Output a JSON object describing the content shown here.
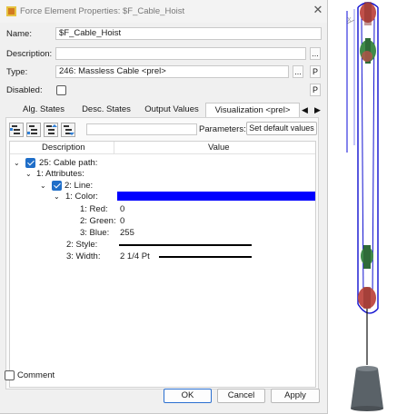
{
  "window": {
    "title": "Force Element Properties: $F_Cable_Hoist"
  },
  "form": {
    "name_label": "Name:",
    "name_value": "$F_Cable_Hoist",
    "description_label": "Description:",
    "description_value": "",
    "type_label": "Type:",
    "type_value": "246: Massless Cable <prel>",
    "disabled_label": "Disabled:",
    "disabled_checked": false,
    "ellipsis_label": "...",
    "p_label": "P"
  },
  "tabs": [
    {
      "label": "Alg. States",
      "active": false
    },
    {
      "label": "Desc. States",
      "active": false
    },
    {
      "label": "Output Values",
      "active": false
    },
    {
      "label": "Visualization <prel>",
      "active": true
    }
  ],
  "tab_nav": {
    "prev": "◀",
    "next": "▶"
  },
  "toolbar": {
    "parameters_label": "Parameters:",
    "set_default_label": "Set default values"
  },
  "tree": {
    "col_description": "Description",
    "col_value": "Value",
    "nodes": {
      "cable_path": "25: Cable path:",
      "attributes": "1: Attributes:",
      "line": "2: Line:",
      "color": "1: Color:",
      "red": "1: Red:",
      "green": "2: Green:",
      "blue": "3: Blue:",
      "style": "2: Style:",
      "width": "3: Width:"
    },
    "values": {
      "red": "0",
      "green": "0",
      "blue": "255",
      "width": "2 1/4 Pt"
    },
    "color_swatch": "#0000ff"
  },
  "footer": {
    "comment_label": "Comment",
    "ok_label": "OK",
    "cancel_label": "Cancel",
    "apply_label": "Apply"
  },
  "colors": {
    "accent": "#1f6ec8",
    "cable": "#1010d0",
    "pulley": "#c0504a",
    "pulley_hub": "#3f8a4a",
    "weight": "#5a6268"
  }
}
